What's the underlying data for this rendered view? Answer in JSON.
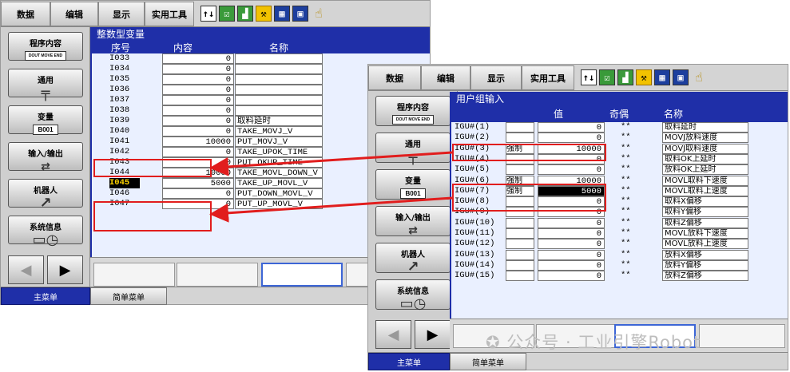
{
  "left_panel": {
    "menu": {
      "data": "数据",
      "edit": "编辑",
      "display": "显示",
      "utility": "实用工具"
    },
    "sidebar": {
      "program": "程序内容",
      "program_tag": "DOUT MOVE END",
      "general": "通用",
      "variable": "变量",
      "variable_tag": "B001",
      "io": "输入/输出",
      "io_sub": "In Out",
      "robot": "机器人",
      "sysinfo": "系统信息"
    },
    "title": "整数型变量",
    "headers": {
      "no": "序号",
      "content": "内容",
      "name": "名称"
    },
    "rows": [
      {
        "no": "I033",
        "val": "0",
        "name": ""
      },
      {
        "no": "I034",
        "val": "0",
        "name": ""
      },
      {
        "no": "I035",
        "val": "0",
        "name": ""
      },
      {
        "no": "I036",
        "val": "0",
        "name": ""
      },
      {
        "no": "I037",
        "val": "0",
        "name": ""
      },
      {
        "no": "I038",
        "val": "0",
        "name": ""
      },
      {
        "no": "I039",
        "val": "0",
        "name": "取料延时"
      },
      {
        "no": "I040",
        "val": "0",
        "name": "TAKE_MOVJ_V"
      },
      {
        "no": "I041",
        "val": "10000",
        "name": "PUT_MOVJ_V"
      },
      {
        "no": "I042",
        "val": "0",
        "name": "TAKE_UPOK_TIME"
      },
      {
        "no": "I043",
        "val": "0",
        "name": "PUT_OKUP_TIME"
      },
      {
        "no": "I044",
        "val": "10000",
        "name": "TAKE_MOVL_DOWN_V"
      },
      {
        "no": "I045",
        "val": "5000",
        "name": "TAKE_UP_MOVL_V"
      },
      {
        "no": "I046",
        "val": "0",
        "name": "PUT_DOWN_MOVL_V"
      },
      {
        "no": "I047",
        "val": "0",
        "name": "PUT_UP_MOVL_V"
      }
    ],
    "bottom": {
      "main_menu": "主菜单",
      "simple_menu": "简单菜单"
    }
  },
  "right_panel": {
    "menu": {
      "data": "数据",
      "edit": "编辑",
      "display": "显示",
      "utility": "实用工具"
    },
    "sidebar": {
      "program": "程序内容",
      "program_tag": "DOUT MOVE END",
      "general": "通用",
      "variable": "变量",
      "variable_tag": "B001",
      "io": "输入/输出",
      "io_sub": "In Out",
      "robot": "机器人",
      "sysinfo": "系统信息"
    },
    "title": "用户组输入",
    "headers": {
      "value": "值",
      "parity": "奇偶",
      "name": "名称"
    },
    "rows": [
      {
        "no": "IGU#(1)",
        "force": "",
        "val": "0",
        "parity": "**",
        "name": "取料延时"
      },
      {
        "no": "IGU#(2)",
        "force": "",
        "val": "0",
        "parity": "**",
        "name": "MOVJ放料速度"
      },
      {
        "no": "IGU#(3)",
        "force": "强制",
        "val": "10000",
        "parity": "**",
        "name": "MOVJ取料速度"
      },
      {
        "no": "IGU#(4)",
        "force": "",
        "val": "0",
        "parity": "**",
        "name": "取料OK上延时"
      },
      {
        "no": "IGU#(5)",
        "force": "",
        "val": "0",
        "parity": "**",
        "name": "放料OK上延时"
      },
      {
        "no": "IGU#(6)",
        "force": "强制",
        "val": "10000",
        "parity": "**",
        "name": "MOVL取料下速度"
      },
      {
        "no": "IGU#(7)",
        "force": "强制",
        "val": "5000",
        "parity": "**",
        "name": "MOVL取料上速度"
      },
      {
        "no": "IGU#(8)",
        "force": "",
        "val": "0",
        "parity": "**",
        "name": "取料X偏移"
      },
      {
        "no": "IGU#(9)",
        "force": "",
        "val": "0",
        "parity": "**",
        "name": "取料Y偏移"
      },
      {
        "no": "IGU#(10)",
        "force": "",
        "val": "0",
        "parity": "**",
        "name": "取料Z偏移"
      },
      {
        "no": "IGU#(11)",
        "force": "",
        "val": "0",
        "parity": "**",
        "name": "MOVL放料下速度"
      },
      {
        "no": "IGU#(12)",
        "force": "",
        "val": "0",
        "parity": "**",
        "name": "MOVL放料上速度"
      },
      {
        "no": "IGU#(13)",
        "force": "",
        "val": "0",
        "parity": "**",
        "name": "放料X偏移"
      },
      {
        "no": "IGU#(14)",
        "force": "",
        "val": "0",
        "parity": "**",
        "name": "放料Y偏移"
      },
      {
        "no": "IGU#(15)",
        "force": "",
        "val": "0",
        "parity": "**",
        "name": "放料Z偏移"
      }
    ],
    "bottom": {
      "main_menu": "主菜单",
      "simple_menu": "简单菜单"
    }
  },
  "watermark": "公众号 · 工业引擎Robot",
  "colors": {
    "title_bar": "#1f2fa8",
    "content_bg": "#eaf0ff",
    "highlight": "#e11d1d"
  }
}
